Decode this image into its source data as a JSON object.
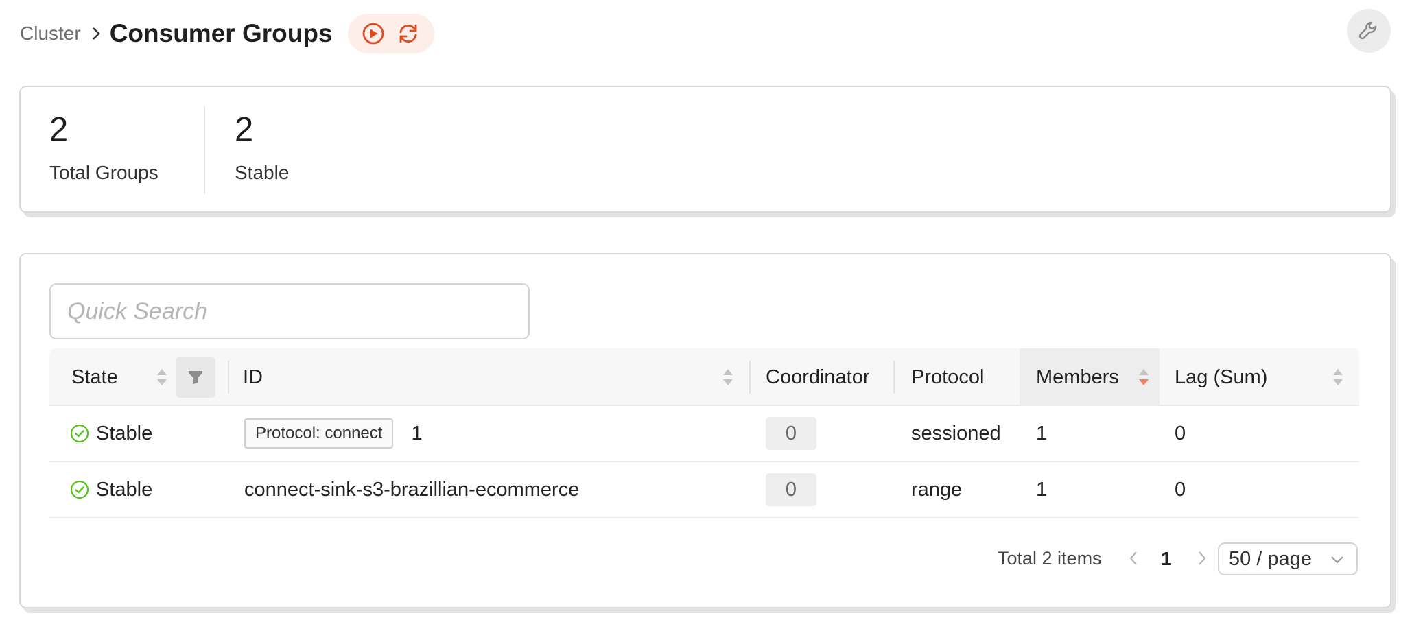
{
  "breadcrumb": {
    "parent": "Cluster",
    "title": "Consumer Groups"
  },
  "actions": {
    "play": "play-icon",
    "refresh": "refresh-icon",
    "settings": "wrench-icon"
  },
  "stats": [
    {
      "value": "2",
      "label": "Total Groups"
    },
    {
      "value": "2",
      "label": "Stable"
    }
  ],
  "search": {
    "placeholder": "Quick Search",
    "value": ""
  },
  "table": {
    "columns": [
      "State",
      "ID",
      "Coordinator",
      "Protocol",
      "Members",
      "Lag (Sum)"
    ],
    "rows": [
      {
        "state": "Stable",
        "tag": "Protocol: connect",
        "id": "1",
        "coordinator": "0",
        "protocol": "sessioned",
        "members": "1",
        "lag": "0"
      },
      {
        "state": "Stable",
        "tag": "",
        "id": "connect-sink-s3-brazillian-ecommerce",
        "coordinator": "0",
        "protocol": "range",
        "members": "1",
        "lag": "0"
      }
    ]
  },
  "pagination": {
    "total": "Total 2 items",
    "current": "1",
    "page_size": "50 / page"
  },
  "colors": {
    "accent": "#e04a1f",
    "success": "#52c41a",
    "sort_active": "#f4845f"
  }
}
